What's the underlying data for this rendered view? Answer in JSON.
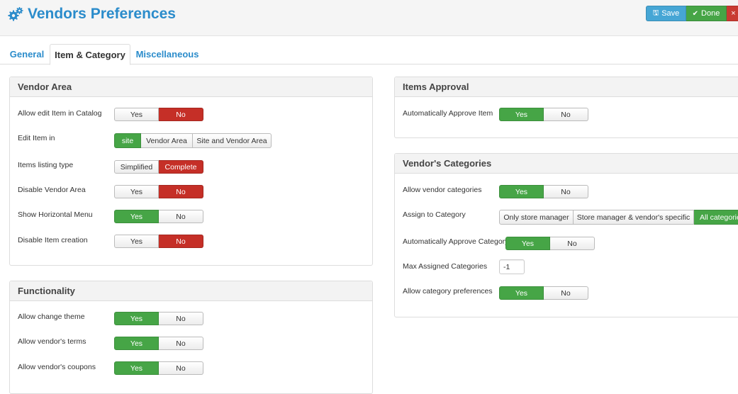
{
  "header": {
    "title": "Vendors Preferences",
    "title_icon": "gears-icon"
  },
  "toolbar": {
    "save_label": "Save",
    "done_label": "Done",
    "close_glyph": "×"
  },
  "tabs": [
    "General",
    "Item & Category",
    "Miscellaneous"
  ],
  "active_tab": "Item & Category",
  "colors": {
    "accent": "#2b8ccb",
    "green": "#46a546",
    "red": "#c52f27",
    "save_blue": "#46a6d5"
  },
  "vendor_area": {
    "title": "Vendor Area",
    "rows": [
      {
        "label": "Allow edit Item in Catalog",
        "options": [
          "Yes",
          "No"
        ],
        "selected": "No"
      },
      {
        "label": "Edit Item in",
        "options": [
          "site",
          "Vendor Area",
          "Site and Vendor Area"
        ],
        "selected": "site"
      },
      {
        "label": "Items listing type",
        "options": [
          "Simplified",
          "Complete"
        ],
        "selected": "Complete"
      },
      {
        "label": "Disable Vendor Area",
        "options": [
          "Yes",
          "No"
        ],
        "selected": "No"
      },
      {
        "label": "Show Horizontal Menu",
        "options": [
          "Yes",
          "No"
        ],
        "selected": "Yes"
      },
      {
        "label": "Disable Item creation",
        "options": [
          "Yes",
          "No"
        ],
        "selected": "No"
      }
    ]
  },
  "functionality": {
    "title": "Functionality",
    "rows": [
      {
        "label": "Allow change theme",
        "options": [
          "Yes",
          "No"
        ],
        "selected": "Yes"
      },
      {
        "label": "Allow vendor's terms",
        "options": [
          "Yes",
          "No"
        ],
        "selected": "Yes"
      },
      {
        "label": "Allow vendor's coupons",
        "options": [
          "Yes",
          "No"
        ],
        "selected": "Yes"
      }
    ]
  },
  "items_approval": {
    "title": "Items Approval",
    "rows": [
      {
        "label": "Automatically Approve Item",
        "options": [
          "Yes",
          "No"
        ],
        "selected": "Yes"
      }
    ]
  },
  "vendor_categories": {
    "title": "Vendor's Categories",
    "rows": [
      {
        "label": "Allow vendor categories",
        "options": [
          "Yes",
          "No"
        ],
        "selected": "Yes"
      },
      {
        "label": "Assign to Category",
        "options": [
          "Only store manager",
          "Store manager & vendor's specific",
          "All categories"
        ],
        "selected": "All categories"
      },
      {
        "label": "Automatically Approve Category",
        "options": [
          "Yes",
          "No"
        ],
        "selected": "Yes"
      },
      {
        "label": "Max Assigned Categories",
        "input_value": "-1"
      },
      {
        "label": "Allow category preferences",
        "options": [
          "Yes",
          "No"
        ],
        "selected": "Yes"
      }
    ]
  }
}
